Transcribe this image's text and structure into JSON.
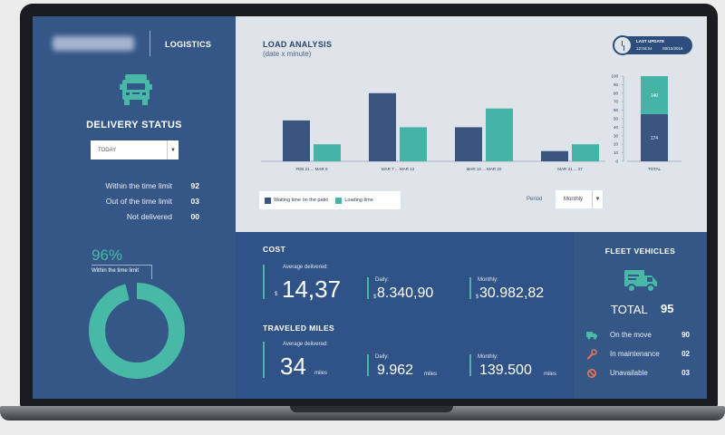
{
  "app": {
    "title": "LOGISTICS"
  },
  "delivery": {
    "title": "DELIVERY STATUS",
    "filter": "TODAY",
    "rows": [
      {
        "label": "Within the time limit",
        "value": "92"
      },
      {
        "label": "Out of the time limit",
        "value": "03"
      },
      {
        "label": "Not delivered",
        "value": "00"
      }
    ],
    "percent": "96%",
    "percent_label": "Within the time limit",
    "donut_fraction": 0.96
  },
  "load_analysis": {
    "title": "LOAD ANALYSIS",
    "subtitle": "(date x minute)",
    "last_update": {
      "label": "LAST UPDATE",
      "time": "12:04:24",
      "date": "08/12/2016"
    },
    "legend": [
      "Waiting time on the patio",
      "Loading time"
    ],
    "period_label": "Period",
    "period_value": "Monthly"
  },
  "chart_data": {
    "type": "bar",
    "categories": [
      "FEB 21 ... MAR 6",
      "MAR 7 ... MAR 13",
      "MAR 14 ... MAR 20",
      "MAR 21 ... 27"
    ],
    "series": [
      {
        "name": "Waiting time on the patio",
        "values": [
          48,
          80,
          40,
          12
        ]
      },
      {
        "name": "Loading time",
        "values": [
          20,
          40,
          62,
          20
        ]
      }
    ],
    "ylim": [
      0,
      100
    ],
    "yticks": [
      "100",
      "90",
      "80",
      "70",
      "60",
      "50",
      "40",
      "30",
      "20",
      "10",
      "0"
    ],
    "total": {
      "label": "TOTAL",
      "segments": [
        174,
        140
      ],
      "segment_labels": [
        "174",
        "140"
      ]
    },
    "colors": {
      "waiting": "#3a557f",
      "loading": "#45b3a5"
    }
  },
  "cost": {
    "title": "COST",
    "average_label": "Average delivered:",
    "average_prefix": "$",
    "average_value": "14,37",
    "daily_label": "Daily:",
    "daily_prefix": "$",
    "daily_value": "8.340,90",
    "monthly_label": "Monthly:",
    "monthly_prefix": "$",
    "monthly_value": "30.982,82"
  },
  "miles": {
    "title": "TRAVELED MILES",
    "average_label": "Average delivered:",
    "average_value": "34",
    "average_unit": "miles",
    "daily_label": "Daily:",
    "daily_value": "9.962",
    "daily_unit": "miles",
    "monthly_label": "Monthly:",
    "monthly_value": "139.500",
    "monthly_unit": "miles"
  },
  "fleet": {
    "title": "FLEET VEHICLES",
    "total_label": "TOTAL",
    "total_value": "95",
    "rows": [
      {
        "label": "On the move",
        "value": "90",
        "icon": "truck-icon"
      },
      {
        "label": "In maintenance",
        "value": "02",
        "icon": "wrench-icon"
      },
      {
        "label": "Unavailable",
        "value": "03",
        "icon": "prohibited-icon"
      }
    ]
  },
  "colors": {
    "accent": "#48b8a7",
    "panel": "#355787",
    "panel_dark": "#2f5287",
    "light": "#dfe3ea"
  }
}
